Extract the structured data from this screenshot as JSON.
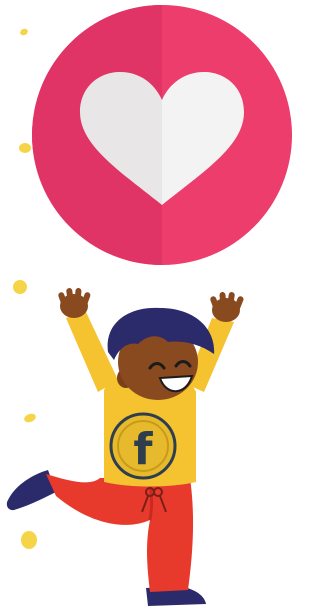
{
  "illustration": {
    "badge": {
      "icon": "heart-icon",
      "circle_color": "#ec3d6c",
      "circle_shade_color": "#e13466",
      "heart_color": "#f4f3f3",
      "heart_shade_color": "#e8e6e6"
    },
    "character": {
      "shirt_color": "#f5c230",
      "pants_color": "#e83a2c",
      "hair_color": "#2b2a6b",
      "skin_color": "#8a4a20",
      "shoe_color": "#2b2a6b",
      "coin": {
        "letter": "f",
        "fill_color": "#e7b92c",
        "letter_color": "#2f3e4e"
      }
    },
    "confetti_color": "#f5d447"
  }
}
